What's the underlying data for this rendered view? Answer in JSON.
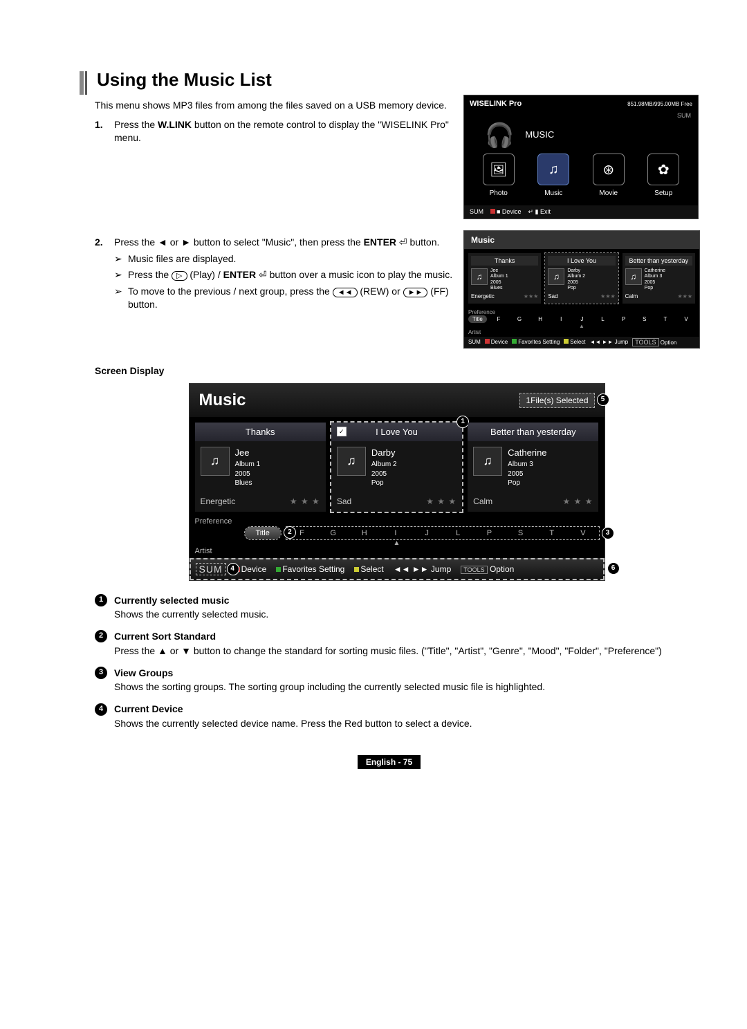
{
  "section_title": "Using the Music List",
  "intro": "This menu shows MP3 files from among the files saved on a USB memory device.",
  "steps": [
    {
      "num": "1.",
      "text": "Press the W.LINK button on the remote control to display the \"WISELINK Pro\" menu.",
      "bold_word": "W.LINK"
    },
    {
      "num": "2.",
      "text": "Press the ◄ or ► button to select \"Music\", then press the ENTER ⏎ button.",
      "bold_word": "ENTER",
      "subs": [
        "Music files are displayed.",
        "Press the  ▷  (Play) / ENTER ⏎ button over a music icon to play the music.",
        "To move to the previous / next group, press the  ◄◄  (REW) or  ►►  (FF) button."
      ]
    }
  ],
  "thumb1": {
    "title": "WISELINK Pro",
    "storage": "851.98MB/995.00MB Free",
    "sum": "SUM",
    "subtitle": "MUSIC",
    "icons": [
      {
        "label": "Photo",
        "glyph": "🖼"
      },
      {
        "label": "Music",
        "glyph": "♫",
        "selected": true
      },
      {
        "label": "Movie",
        "glyph": "⊛"
      },
      {
        "label": "Setup",
        "glyph": "✿"
      }
    ],
    "footer": [
      "SUM",
      "■ Device",
      "↵ ▮ Exit"
    ]
  },
  "thumb2": {
    "title": "Music",
    "groups": [
      {
        "name": "Thanks",
        "track": "Jee",
        "album": "Album 1",
        "year": "2005",
        "genre": "Blues",
        "mood": "Energetic"
      },
      {
        "name": "I Love You",
        "track": "Darby",
        "album": "Album 2",
        "year": "2005",
        "genre": "Pop",
        "mood": "Sad",
        "selected": true
      },
      {
        "name": "Better than yesterday",
        "track": "Catherine",
        "album": "Album 3",
        "year": "2005",
        "genre": "Pop",
        "mood": "Calm"
      }
    ],
    "sort": {
      "pref": "Preference",
      "selected": "Title",
      "row": [
        "F",
        "G",
        "H",
        "I",
        "J",
        "L",
        "P",
        "S",
        "T",
        "V"
      ],
      "artist": "Artist"
    },
    "bottom": [
      "SUM",
      "Device",
      "Favorites Setting",
      "Select",
      "Jump",
      "Option"
    ]
  },
  "screen_display_label": "Screen Display",
  "bigshot": {
    "title": "Music",
    "sel_count": "1File(s) Selected",
    "groups": [
      {
        "name": "Thanks",
        "track": "Jee",
        "album": "Album 1",
        "year": "2005",
        "genre": "Blues",
        "mood": "Energetic"
      },
      {
        "name": "I Love You",
        "track": "Darby",
        "album": "Album 2",
        "year": "2005",
        "genre": "Pop",
        "mood": "Sad",
        "selected": true,
        "checked": true
      },
      {
        "name": "Better than yesterday",
        "track": "Catherine",
        "album": "Album 3",
        "year": "2005",
        "genre": "Pop",
        "mood": "Calm"
      }
    ],
    "stars": "★ ★ ★",
    "sort": {
      "pref": "Preference",
      "pill": "Title",
      "letters": [
        "F",
        "G",
        "H",
        "I",
        "J",
        "L",
        "P",
        "S",
        "T",
        "V"
      ],
      "artist": "Artist"
    },
    "foot": {
      "sum": "SUM",
      "device": "Device",
      "fav": "Favorites Setting",
      "select": "Select",
      "jump": "Jump",
      "option": "Option",
      "tools": "TOOLS"
    },
    "callouts": {
      "1": "1",
      "2": "2",
      "3": "3",
      "4": "4",
      "5": "5",
      "6": "6"
    }
  },
  "legend": [
    {
      "n": "1",
      "t": "Currently selected music",
      "d": "Shows the currently selected music."
    },
    {
      "n": "2",
      "t": "Current Sort Standard",
      "d": "Press the ▲ or ▼ button to change the standard for sorting music files. (\"Title\", \"Artist\", \"Genre\", \"Mood\", \"Folder\", \"Preference\")"
    },
    {
      "n": "3",
      "t": "View Groups",
      "d": "Shows the sorting groups. The sorting group including the currently selected music file is highlighted."
    },
    {
      "n": "4",
      "t": "Current Device",
      "d": "Shows the currently selected device name. Press the Red button to select a device."
    }
  ],
  "footer": "English - 75"
}
